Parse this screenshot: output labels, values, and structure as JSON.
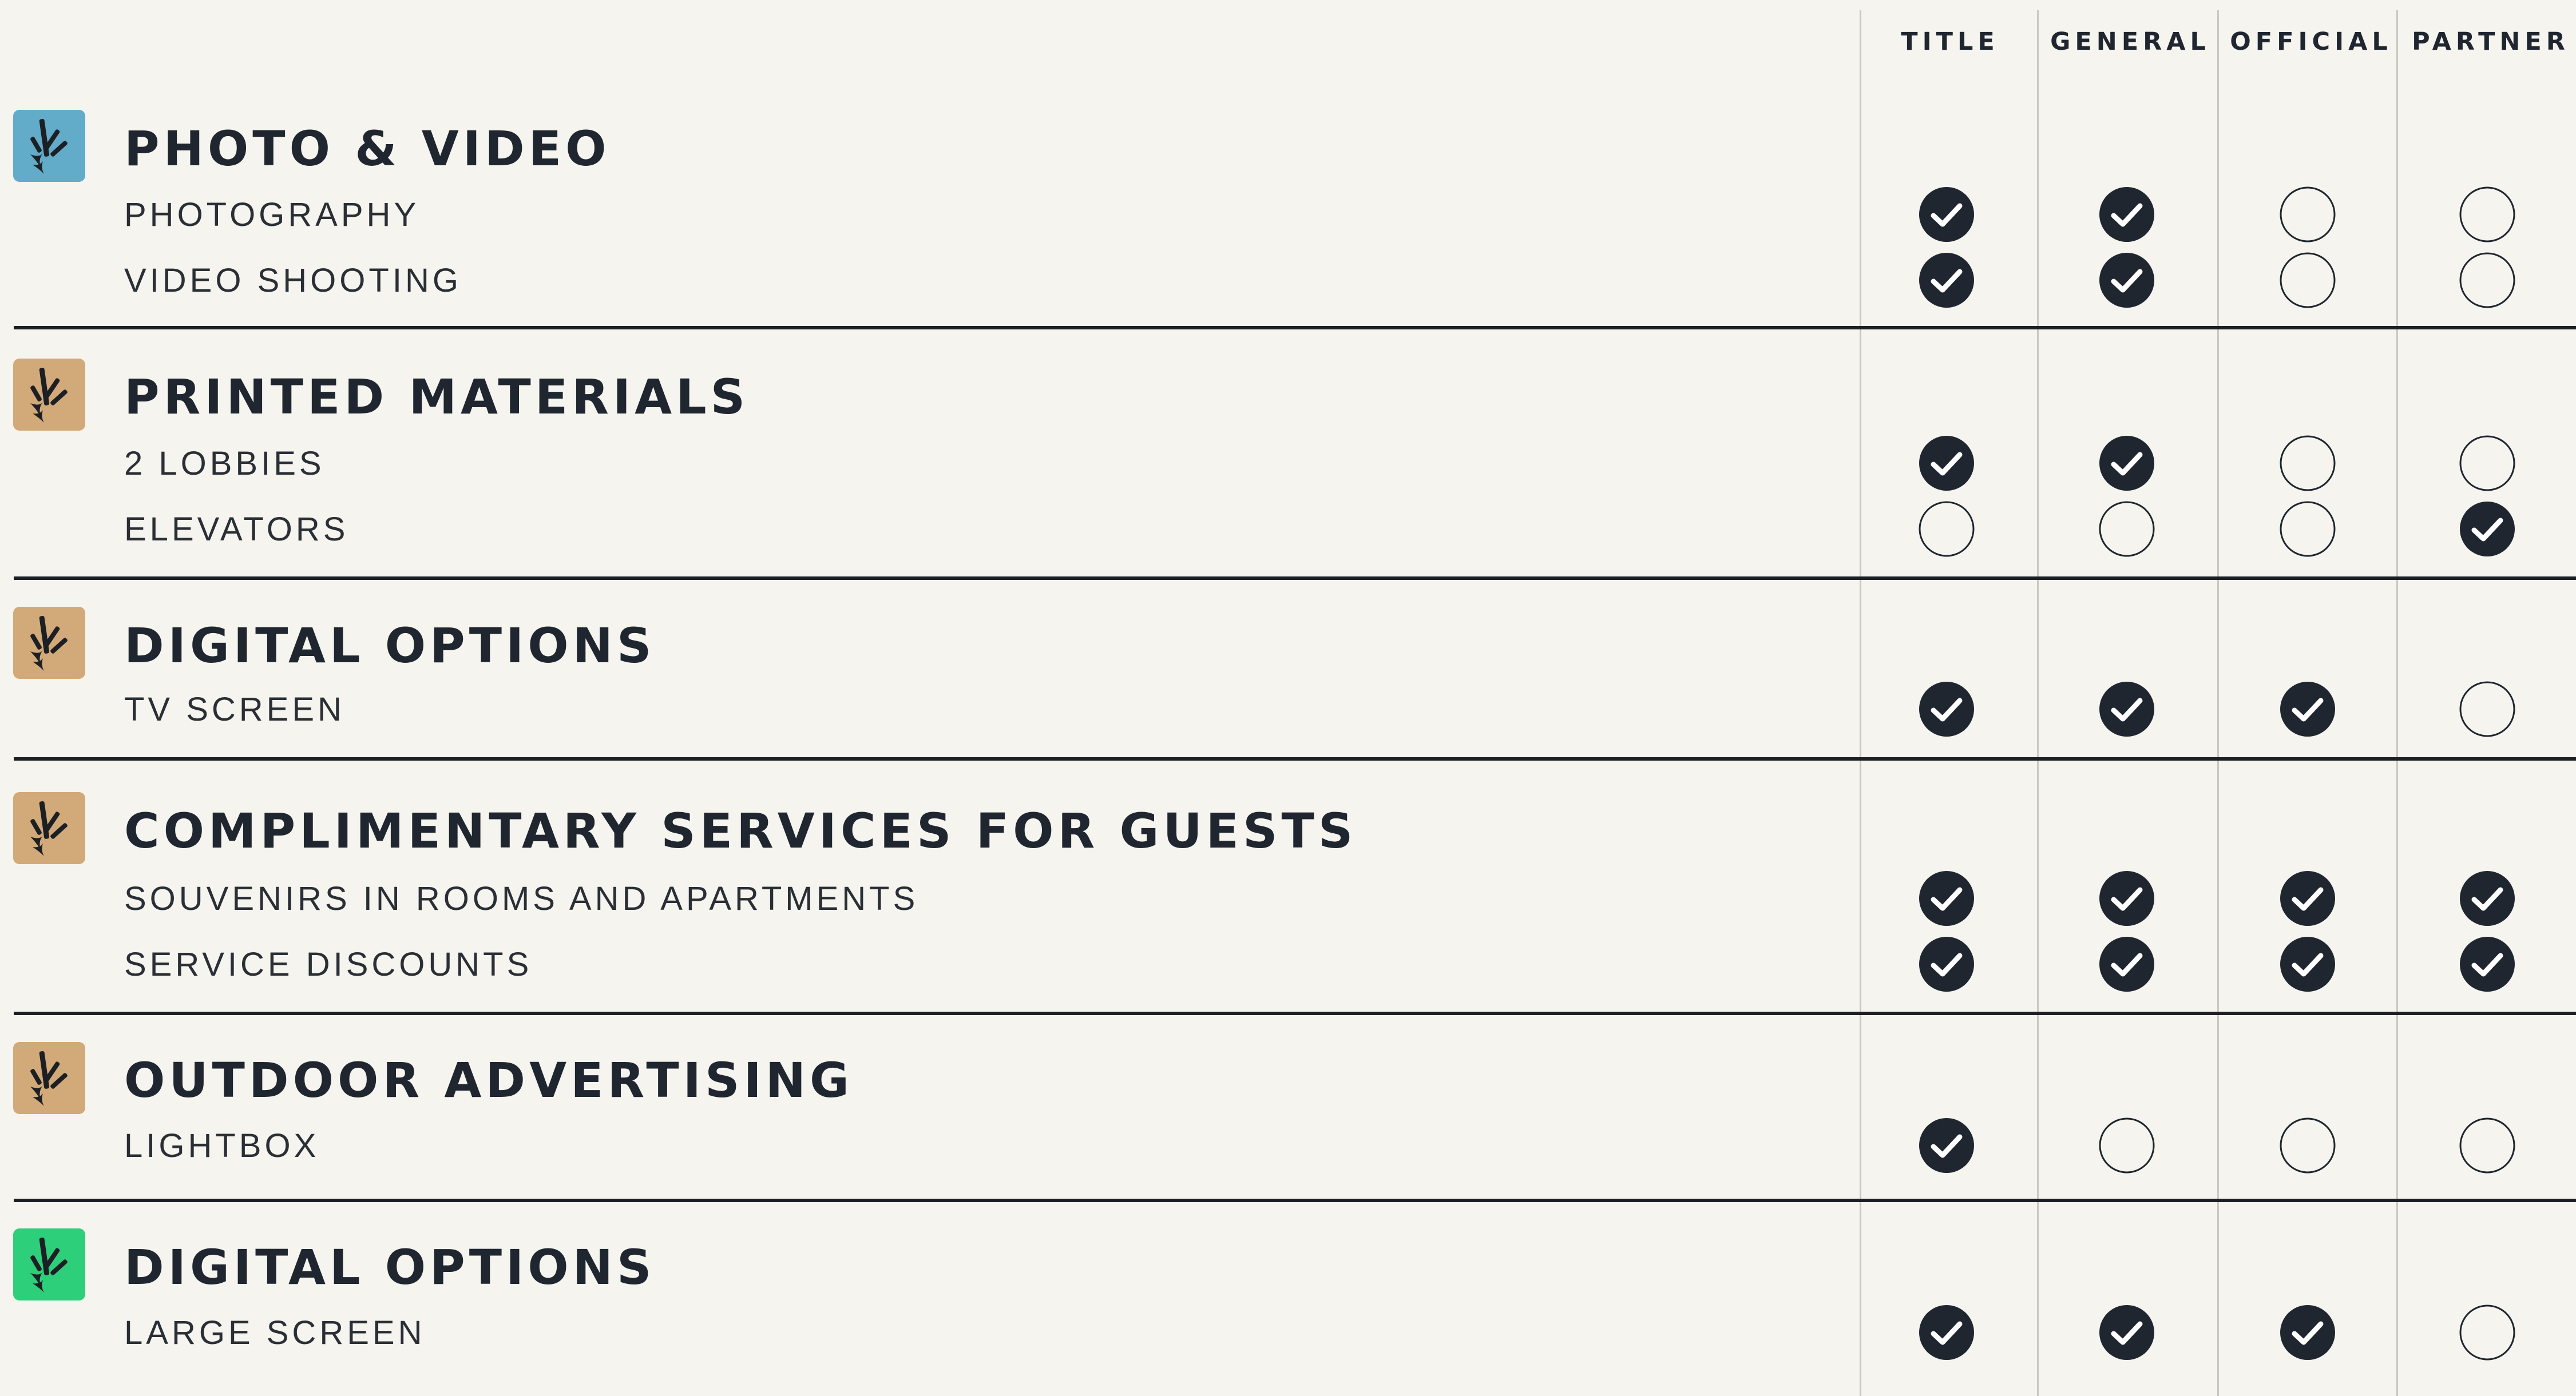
{
  "columns": [
    "TITLE",
    "GENERAL",
    "OFFICIAL",
    "PARTNER"
  ],
  "colors": {
    "background": "#f5f4ee",
    "ink": "#1f2630",
    "icon_blue": "#62abc9",
    "icon_tan": "#d2a978",
    "icon_green": "#2ecf7a"
  },
  "categories": [
    {
      "title": "PHOTO & VIDEO",
      "icon": "wheat-logo-icon",
      "icon_color": "#62abc9",
      "items": [
        {
          "label": "PHOTOGRAPHY",
          "checks": [
            true,
            true,
            false,
            false
          ]
        },
        {
          "label": "VIDEO SHOOTING",
          "checks": [
            true,
            true,
            false,
            false
          ]
        }
      ]
    },
    {
      "title": "PRINTED MATERIALS",
      "icon": "wheat-logo-icon",
      "icon_color": "#d2a978",
      "items": [
        {
          "label": "2 LOBBIES",
          "checks": [
            true,
            true,
            false,
            false
          ]
        },
        {
          "label": "ELEVATORS",
          "checks": [
            false,
            false,
            false,
            true
          ]
        }
      ]
    },
    {
      "title": "DIGITAL OPTIONS",
      "icon": "wheat-logo-icon",
      "icon_color": "#d2a978",
      "items": [
        {
          "label": "TV SCREEN",
          "checks": [
            true,
            true,
            true,
            false
          ]
        }
      ]
    },
    {
      "title": "COMPLIMENTARY SERVICES FOR GUESTS",
      "icon": "wheat-logo-icon",
      "icon_color": "#d2a978",
      "items": [
        {
          "label": "SOUVENIRS IN ROOMS AND APARTMENTS",
          "checks": [
            true,
            true,
            true,
            true
          ]
        },
        {
          "label": "SERVICE DISCOUNTS",
          "checks": [
            true,
            true,
            true,
            true
          ]
        }
      ]
    },
    {
      "title": "OUTDOOR ADVERTISING",
      "icon": "wheat-logo-icon",
      "icon_color": "#d2a978",
      "items": [
        {
          "label": "LIGHTBOX",
          "checks": [
            true,
            false,
            false,
            false
          ]
        }
      ]
    },
    {
      "title": "DIGITAL OPTIONS",
      "icon": "wheat-logo-icon",
      "icon_color": "#2ecf7a",
      "items": [
        {
          "label": "LARGE SCREEN",
          "checks": [
            true,
            true,
            true,
            false
          ]
        }
      ]
    }
  ]
}
